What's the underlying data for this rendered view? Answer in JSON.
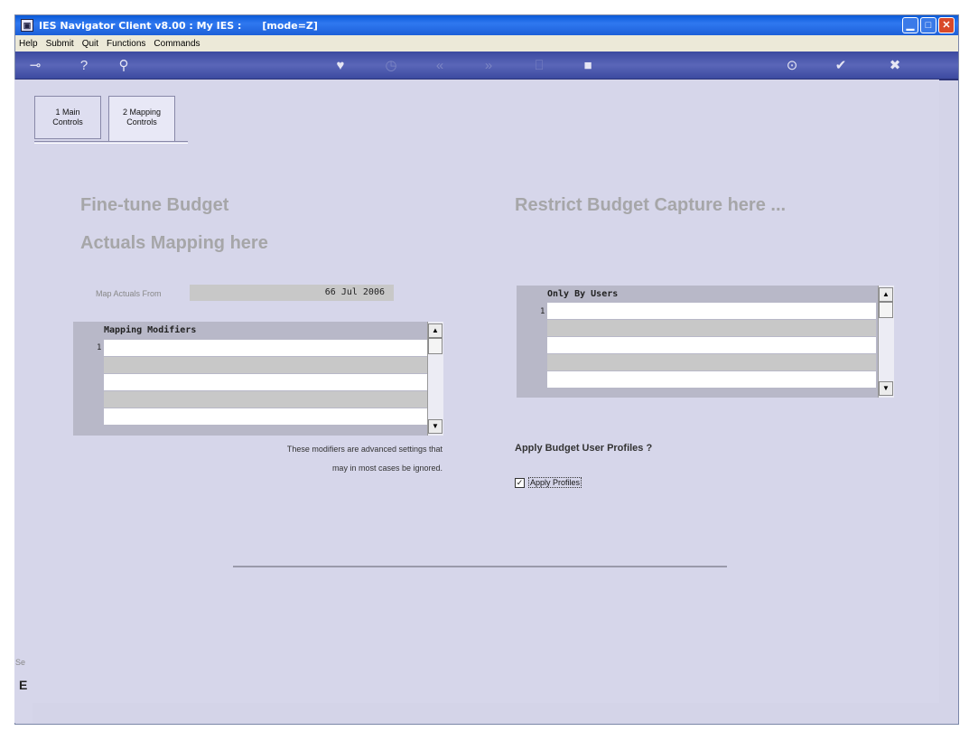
{
  "window": {
    "title": "IES Navigator Client v8.00 : My IES :      [mode=Z]",
    "icon": "app-icon",
    "controls": [
      "minimize-icon",
      "maximize-icon",
      "close-icon"
    ]
  },
  "menu": [
    "Help",
    "Submit",
    "Quit",
    "Functions",
    "Commands"
  ],
  "toolbar": {
    "icons": [
      "key-icon",
      "help-icon",
      "search-icon",
      "heart-icon",
      "clock-icon",
      "first-icon",
      "last-icon",
      "new-icon",
      "stop-icon",
      "record-icon",
      "ok-icon",
      "cancel-icon"
    ]
  },
  "tabs": [
    {
      "line1": "1 Main",
      "line2": "Controls"
    },
    {
      "line1": "2 Mapping",
      "line2": "Controls"
    }
  ],
  "left": {
    "heading1": "Fine-tune Budget",
    "heading2": "Actuals Mapping here",
    "map_label": "Map Actuals From",
    "map_value": "66 Jul 2006",
    "grid_header": "Mapping Modifiers",
    "first_row": "1",
    "note1": "These modifiers are advanced settings that",
    "note2": "may in most cases be ignored."
  },
  "right": {
    "heading": "Restrict Budget Capture here ...",
    "grid_header": "Only By Users",
    "first_row": "1",
    "subheading": "Apply Budget User Profiles ?",
    "checkbox_label": "Apply Profiles",
    "checkbox_checked": true
  },
  "status": {
    "label": "Se",
    "glyph": "E"
  }
}
